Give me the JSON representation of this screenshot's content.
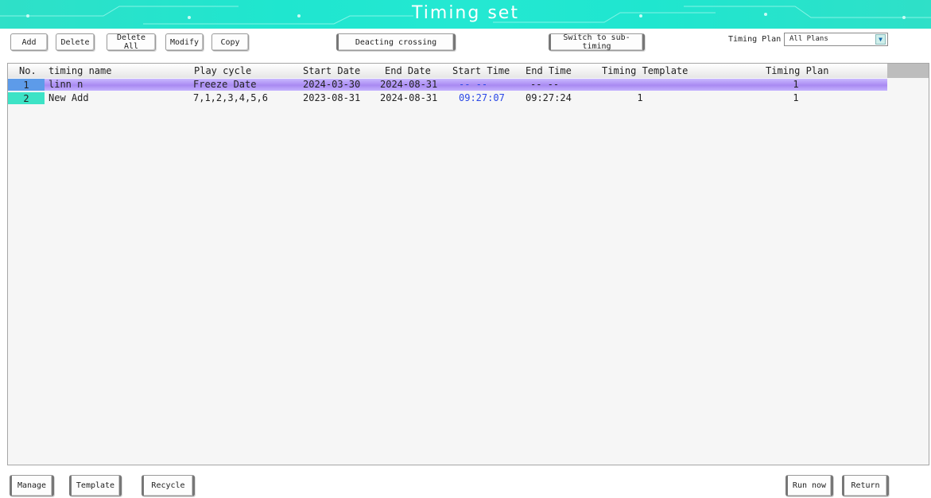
{
  "window": {
    "title": "Timing set"
  },
  "toolbar": {
    "add": "Add",
    "delete": "Delete",
    "delete_all": "Delete All",
    "modify": "Modify",
    "copy": "Copy",
    "deacting_crossing": "Deacting crossing",
    "switch_sub_timing": "Switch to sub-timing",
    "timing_plan_label": "Timing Plan",
    "timing_plan_value": "All Plans"
  },
  "table": {
    "columns": [
      "No.",
      "timing name",
      "Play cycle",
      "Start Date",
      "End Date",
      "Start Time",
      "End Time",
      "Timing Template",
      "Timing Plan"
    ],
    "rows": [
      {
        "no": "1",
        "name": "linn n",
        "cycle": "Freeze Date",
        "start_date": "2024-03-30",
        "end_date": "2024-08-31",
        "start_time": "-- --",
        "end_time": "-- --",
        "template": "",
        "plan": "1"
      },
      {
        "no": "2",
        "name": "New Add",
        "cycle": "7,1,2,3,4,5,6",
        "start_date": "2023-08-31",
        "end_date": "2024-08-31",
        "start_time": "09:27:07",
        "end_time": "09:27:24",
        "template": "1",
        "plan": "1"
      }
    ]
  },
  "footer": {
    "manage": "Manage",
    "template": "Template",
    "recycle": "Recycle",
    "run_now": "Run now",
    "return": "Return"
  },
  "colors": {
    "title_bar": "#24e8d2",
    "selected_row": "#b39cf7",
    "row_number_bg": "#3de3c6",
    "start_time_blue": "#2a48e6"
  },
  "icons": {
    "dropdown": "chevron-down-icon"
  }
}
